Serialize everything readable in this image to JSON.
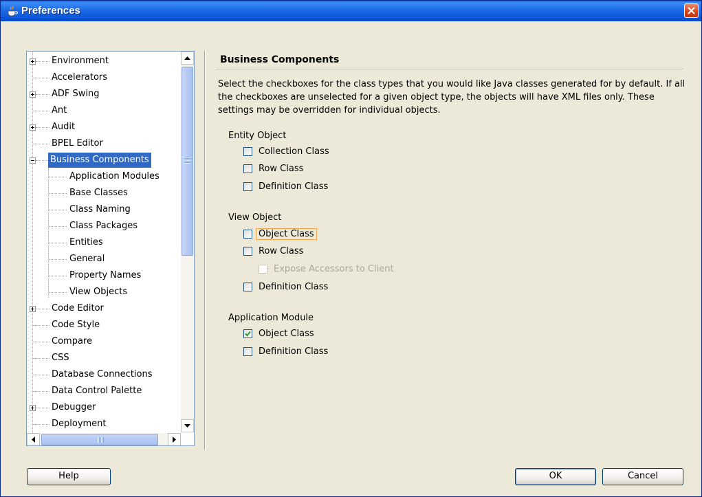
{
  "window": {
    "title": "Preferences"
  },
  "tree": {
    "items": [
      {
        "label": "Environment"
      },
      {
        "label": "Accelerators"
      },
      {
        "label": "ADF Swing"
      },
      {
        "label": "Ant"
      },
      {
        "label": "Audit"
      },
      {
        "label": "BPEL Editor"
      },
      {
        "label": "Business Components"
      },
      {
        "label": "Application Modules"
      },
      {
        "label": "Base Classes"
      },
      {
        "label": "Class Naming"
      },
      {
        "label": "Class Packages"
      },
      {
        "label": "Entities"
      },
      {
        "label": "General"
      },
      {
        "label": "Property Names"
      },
      {
        "label": "View Objects"
      },
      {
        "label": "Code Editor"
      },
      {
        "label": "Code Style"
      },
      {
        "label": "Compare"
      },
      {
        "label": "CSS"
      },
      {
        "label": "Database Connections"
      },
      {
        "label": "Data Control Palette"
      },
      {
        "label": "Debugger"
      },
      {
        "label": "Deployment"
      }
    ]
  },
  "main": {
    "heading": "Business Components",
    "description": "Select the checkboxes for the class types that you would like Java classes generated for by default.  If all the checkboxes are unselected for a given object type, the objects will have XML files only.  These settings may be overridden for individual objects.",
    "entity": {
      "label": "Entity Object",
      "collection": {
        "label": "Collection Class",
        "checked": false
      },
      "row": {
        "label": "Row Class",
        "checked": false
      },
      "definition": {
        "label": "Definition Class",
        "checked": false
      }
    },
    "view": {
      "label": "View Object",
      "object": {
        "label": "Object Class",
        "checked": false
      },
      "row": {
        "label": "Row Class",
        "checked": false
      },
      "expose": {
        "label": "Expose Accessors to Client",
        "checked": false,
        "enabled": false
      },
      "definition": {
        "label": "Definition Class",
        "checked": false
      }
    },
    "appmodule": {
      "label": "Application Module",
      "object": {
        "label": "Object Class",
        "checked": true
      },
      "definition": {
        "label": "Definition Class",
        "checked": false
      }
    }
  },
  "buttons": {
    "help": "Help",
    "ok": "OK",
    "cancel": "Cancel"
  }
}
